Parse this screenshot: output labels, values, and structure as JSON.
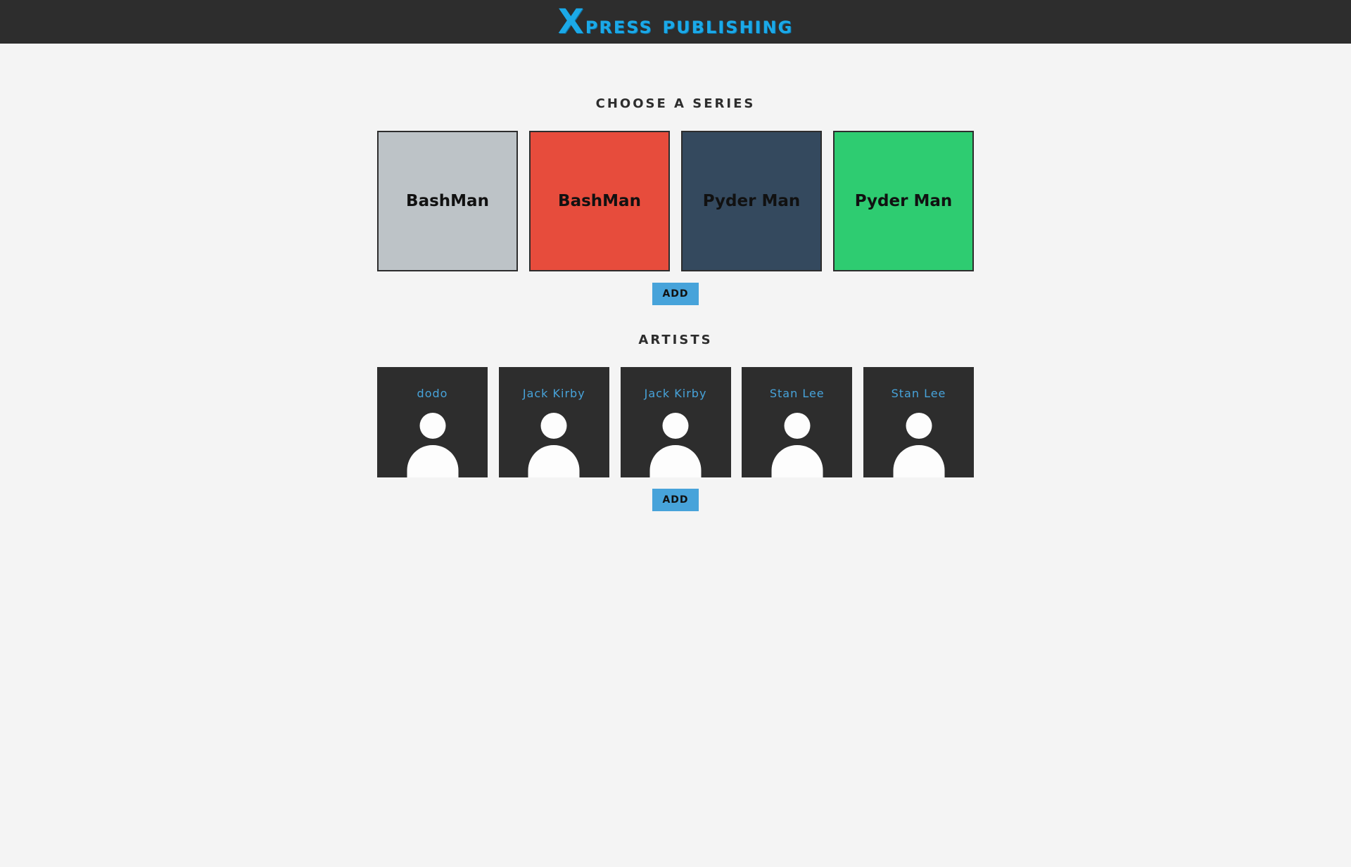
{
  "header": {
    "logo_cap": "X",
    "logo_rest": "press publishing"
  },
  "series_section": {
    "title": "CHOOSE A SERIES",
    "items": [
      {
        "name": "BashMan",
        "color": "#bdc3c7"
      },
      {
        "name": "BashMan",
        "color": "#e74c3c"
      },
      {
        "name": "Pyder Man",
        "color": "#34495e"
      },
      {
        "name": "Pyder Man",
        "color": "#2ecc71"
      }
    ],
    "add_label": "ADD"
  },
  "artists_section": {
    "title": "ARTISTS",
    "items": [
      {
        "name": "dodo"
      },
      {
        "name": "Jack Kirby"
      },
      {
        "name": "Jack Kirby"
      },
      {
        "name": "Stan Lee"
      },
      {
        "name": "Stan Lee"
      }
    ],
    "add_label": "ADD"
  }
}
